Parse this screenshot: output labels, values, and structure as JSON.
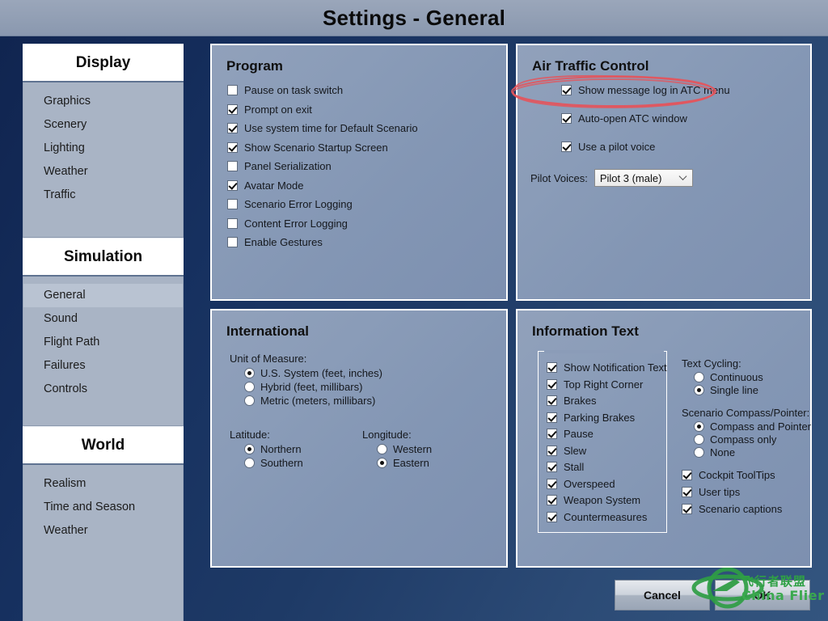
{
  "window": {
    "title": "Settings - General"
  },
  "sidebar": {
    "groups": [
      {
        "header": "Display",
        "items": [
          {
            "label": "Graphics",
            "selected": false
          },
          {
            "label": "Scenery",
            "selected": false
          },
          {
            "label": "Lighting",
            "selected": false
          },
          {
            "label": "Weather",
            "selected": false
          },
          {
            "label": "Traffic",
            "selected": false
          }
        ]
      },
      {
        "header": "Simulation",
        "items": [
          {
            "label": "General",
            "selected": true
          },
          {
            "label": "Sound",
            "selected": false
          },
          {
            "label": "Flight Path",
            "selected": false
          },
          {
            "label": "Failures",
            "selected": false
          },
          {
            "label": "Controls",
            "selected": false
          }
        ]
      },
      {
        "header": "World",
        "items": [
          {
            "label": "Realism",
            "selected": false
          },
          {
            "label": "Time and Season",
            "selected": false
          },
          {
            "label": "Weather",
            "selected": false
          }
        ]
      }
    ]
  },
  "program": {
    "title": "Program",
    "checkboxes": [
      {
        "label": "Pause on task switch",
        "checked": false
      },
      {
        "label": "Prompt on exit",
        "checked": true
      },
      {
        "label": "Use system time for Default Scenario",
        "checked": true
      },
      {
        "label": "Show Scenario Startup Screen",
        "checked": true
      },
      {
        "label": "Panel Serialization",
        "checked": false
      },
      {
        "label": "Avatar Mode",
        "checked": true
      },
      {
        "label": "Scenario Error Logging",
        "checked": false
      },
      {
        "label": "Content Error Logging",
        "checked": false
      },
      {
        "label": "Enable Gestures",
        "checked": false
      }
    ]
  },
  "atc": {
    "title": "Air Traffic Control",
    "checkboxes": [
      {
        "label": "Show message log in ATC menu",
        "checked": true
      },
      {
        "label": "Auto-open ATC window",
        "checked": true
      },
      {
        "label": "Use a pilot voice",
        "checked": true
      }
    ],
    "pilot_voices_label": "Pilot Voices:",
    "pilot_voices_value": "Pilot 3 (male)"
  },
  "international": {
    "title": "International",
    "unit_of_measure_label": "Unit of Measure:",
    "unit_of_measure_options": [
      {
        "label": "U.S. System (feet, inches)",
        "selected": true
      },
      {
        "label": "Hybrid (feet, millibars)",
        "selected": false
      },
      {
        "label": "Metric (meters, millibars)",
        "selected": false
      }
    ],
    "latitude_label": "Latitude:",
    "latitude_options": [
      {
        "label": "Northern",
        "selected": true
      },
      {
        "label": "Southern",
        "selected": false
      }
    ],
    "longitude_label": "Longitude:",
    "longitude_options": [
      {
        "label": "Western",
        "selected": false
      },
      {
        "label": "Eastern",
        "selected": true
      }
    ]
  },
  "information_text": {
    "title": "Information Text",
    "notification_checkboxes": [
      {
        "label": "Show Notification Text",
        "checked": true
      },
      {
        "label": "Top Right Corner",
        "checked": true
      },
      {
        "label": "Brakes",
        "checked": true
      },
      {
        "label": "Parking Brakes",
        "checked": true
      },
      {
        "label": "Pause",
        "checked": true
      },
      {
        "label": "Slew",
        "checked": true
      },
      {
        "label": "Stall",
        "checked": true
      },
      {
        "label": "Overspeed",
        "checked": true
      },
      {
        "label": "Weapon System",
        "checked": true
      },
      {
        "label": "Countermeasures",
        "checked": true
      }
    ],
    "text_cycling_label": "Text Cycling:",
    "text_cycling_options": [
      {
        "label": "Continuous",
        "selected": false
      },
      {
        "label": "Single line",
        "selected": true
      }
    ],
    "compass_label": "Scenario Compass/Pointer:",
    "compass_options": [
      {
        "label": "Compass and Pointer",
        "selected": true
      },
      {
        "label": "Compass only",
        "selected": false
      },
      {
        "label": "None",
        "selected": false
      }
    ],
    "extra_checkboxes": [
      {
        "label": "Cockpit ToolTips",
        "checked": true
      },
      {
        "label": "User tips",
        "checked": true
      },
      {
        "label": "Scenario captions",
        "checked": true
      }
    ]
  },
  "footer": {
    "cancel_label": "Cancel",
    "ok_label": "OK"
  },
  "annotation": {
    "color": "#e4555c",
    "target": "Show message log in ATC menu"
  },
  "watermark": {
    "chinese_text": "飞行者联盟",
    "english_text": "China Flier",
    "color": "#34a44a"
  },
  "colors": {
    "titlebar": "#93a0b5",
    "background_dark": "#10244f",
    "background_light": "#33557f",
    "panel": "#8a9cb8",
    "nav_body": "#a9b4c5",
    "nav_selected": "#b9c3d2"
  }
}
